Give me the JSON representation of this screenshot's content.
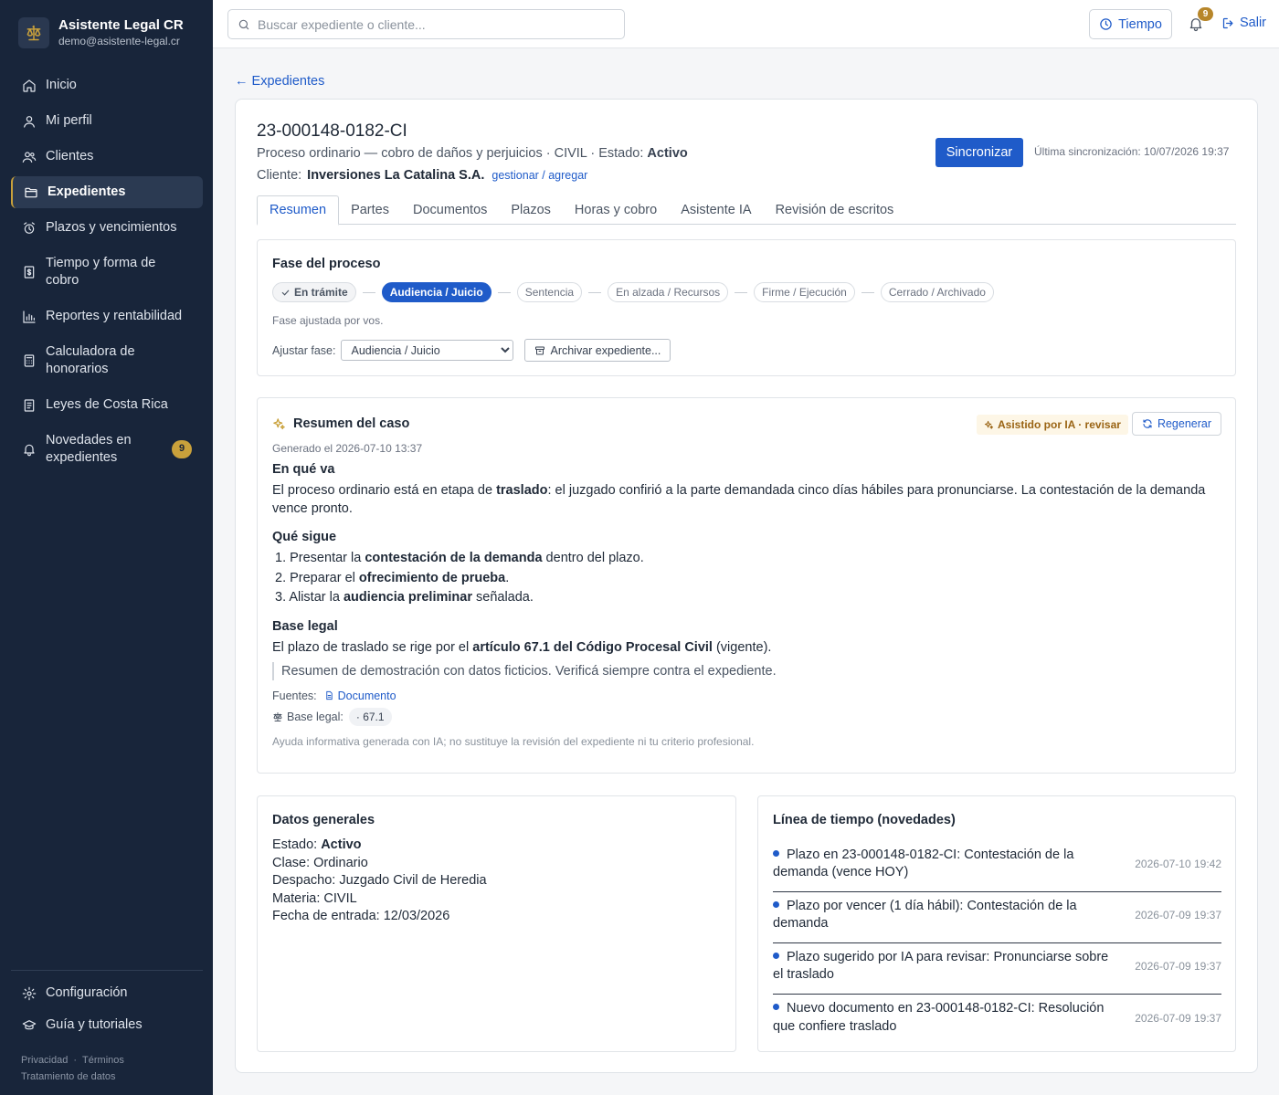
{
  "brand": {
    "name": "Asistente Legal CR",
    "email": "demo@asistente-legal.cr"
  },
  "sidebar": {
    "items": [
      {
        "label": "Inicio",
        "icon": "home-icon"
      },
      {
        "label": "Mi perfil",
        "icon": "user-icon"
      },
      {
        "label": "Clientes",
        "icon": "users-icon"
      },
      {
        "label": "Expedientes",
        "icon": "folder-icon",
        "active": true
      },
      {
        "label": "Plazos y vencimientos",
        "icon": "alarm-icon"
      },
      {
        "label": "Tiempo y forma de cobro",
        "icon": "receipt-icon"
      },
      {
        "label": "Reportes y rentabilidad",
        "icon": "bar-chart-icon"
      },
      {
        "label": "Calculadora de honorarios",
        "icon": "calculator-icon"
      },
      {
        "label": "Leyes de Costa Rica",
        "icon": "book-icon"
      },
      {
        "label": "Novedades en expedientes",
        "icon": "bell-icon",
        "badge": "9"
      }
    ],
    "bottom": [
      {
        "label": "Configuración",
        "icon": "gear-icon"
      },
      {
        "label": "Guía y tutoriales",
        "icon": "graduation-cap-icon"
      }
    ],
    "legal": {
      "privacy": "Privacidad",
      "terms": "Términos",
      "data": "Tratamiento de datos"
    }
  },
  "topbar": {
    "search_placeholder": "Buscar expediente o cliente...",
    "tiempo_label": "Tiempo",
    "notifications_count": "9",
    "salir_label": "Salir"
  },
  "back_link": "← Expedientes",
  "case": {
    "number": "23-000148-0182-CI",
    "description": "Proceso ordinario — cobro de daños y perjuicios · CIVIL · Estado: ",
    "status": "Activo",
    "client_label": "Cliente:",
    "client_name": "Inversiones La Catalina S.A.",
    "client_link": "gestionar / agregar",
    "sync_label": "Sincronizar",
    "last_sync": "Última sincronización: 10/07/2026 19:37"
  },
  "tabs": [
    "Resumen",
    "Partes",
    "Documentos",
    "Plazos",
    "Horas y cobro",
    "Asistente IA",
    "Revisión de escritos"
  ],
  "fase": {
    "title": "Fase del proceso",
    "steps": [
      "En trámite",
      "Audiencia / Juicio",
      "Sentencia",
      "En alzada / Recursos",
      "Firme / Ejecución",
      "Cerrado / Archivado"
    ],
    "note": "Fase ajustada por vos.",
    "adjust_label": "Ajustar fase:",
    "selected": "Audiencia / Juicio",
    "archive_label": "Archivar expediente..."
  },
  "resumen": {
    "title": "Resumen del caso",
    "ia_badge": "Asistido por IA · revisar",
    "regen_label": "Regenerar",
    "generated": "Generado el 2026-07-10 13:37",
    "h1": "En qué va",
    "p1_a": "El proceso ordinario está en etapa de ",
    "p1_b": "traslado",
    "p1_c": ": el juzgado confirió a la parte demandada cinco días hábiles para pronunciarse. La contestación de la demanda vence pronto.",
    "h2": "Qué sigue",
    "list": [
      {
        "a": "1. Presentar la ",
        "b": "contestación de la demanda",
        "c": " dentro del plazo."
      },
      {
        "a": "2. Preparar el ",
        "b": "ofrecimiento de prueba",
        "c": "."
      },
      {
        "a": "3. Alistar la ",
        "b": "audiencia preliminar",
        "c": " señalada."
      }
    ],
    "h3": "Base legal",
    "p3_a": "El plazo de traslado se rige por el ",
    "p3_b": "artículo 67.1 del Código Procesal Civil",
    "p3_c": " (vigente).",
    "quote": "Resumen de demostración con datos ficticios. Verificá siempre contra el expediente.",
    "sources_label": "Fuentes:",
    "source_doc": "Documento",
    "base_label": "Base legal:",
    "article": "· 67.1",
    "ia_note": "Ayuda informativa generada con IA; no sustituye la revisión del expediente ni tu criterio profesional."
  },
  "datos": {
    "title": "Datos generales",
    "estado_label": "Estado: ",
    "estado": "Activo",
    "clase": "Clase: Ordinario",
    "despacho": "Despacho: Juzgado Civil de Heredia",
    "materia": "Materia: CIVIL",
    "fecha": "Fecha de entrada: 12/03/2026"
  },
  "timeline": {
    "title": "Línea de tiempo (novedades)",
    "items": [
      {
        "text": "Plazo en 23-000148-0182-CI: Contestación de la demanda (vence HOY)",
        "date": "2026-07-10 19:42"
      },
      {
        "text": "Plazo por vencer (1 día hábil): Contestación de la demanda",
        "date": "2026-07-09 19:37"
      },
      {
        "text": "Plazo sugerido por IA para revisar: Pronunciarse sobre el traslado",
        "date": "2026-07-09 19:37"
      },
      {
        "text": "Nuevo documento en 23-000148-0182-CI: Resolución que confiere traslado",
        "date": "2026-07-09 19:37"
      }
    ]
  },
  "colors": {
    "sidebar": "#18253a",
    "accent": "#1f5bc9",
    "gold": "#c9a13b"
  }
}
